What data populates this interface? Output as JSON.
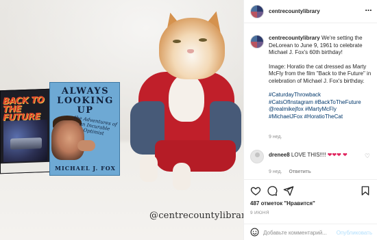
{
  "post": {
    "username": "centrecountylibrary",
    "more_icon": "…",
    "watermark": "@centrecountylibrary"
  },
  "photo": {
    "dvd_title": "BACK TO THE FUTURE",
    "book_title": "ALWAYS LOOKING UP",
    "book_subtitle": "the Adventures of an Incurable Optimist",
    "book_author": "MICHAEL J. FOX"
  },
  "caption": {
    "username": "centrecountylibrary",
    "line1": "We're setting the DeLorean to June 9, 1961 to celebrate Michael J. Fox's 60th birthday!",
    "line2": "Image: Horatio the cat dressed as Marty McFly from the film \"Back to the Future\" in celebration of Michael J. Fox's birthday.",
    "hashtags": [
      "#CaturdayThrowback",
      "#CatsOfInstagram",
      "#BackToTheFuture",
      "@realmikejfox",
      "#MartyMcFly",
      "#MichaelJFox",
      "#HoratioTheCat"
    ],
    "age": "9 нед."
  },
  "comment": {
    "username": "drenee8",
    "text": "LOVE THIS!!!!",
    "hearts": "❤❤❤ ❤",
    "age": "9 нед.",
    "reply_label": "Ответить",
    "like_icon": "heart-outline-icon"
  },
  "actions": {
    "icons": [
      "heart-icon",
      "comment-icon",
      "share-icon",
      "bookmark-icon"
    ],
    "likes": "487 отметок \"Нравится\"",
    "date": "9 ИЮНЯ"
  },
  "add_comment": {
    "placeholder": "Добавьте комментарий...",
    "publish_label": "Опубликовать",
    "publish_color": "#b2dffc"
  }
}
